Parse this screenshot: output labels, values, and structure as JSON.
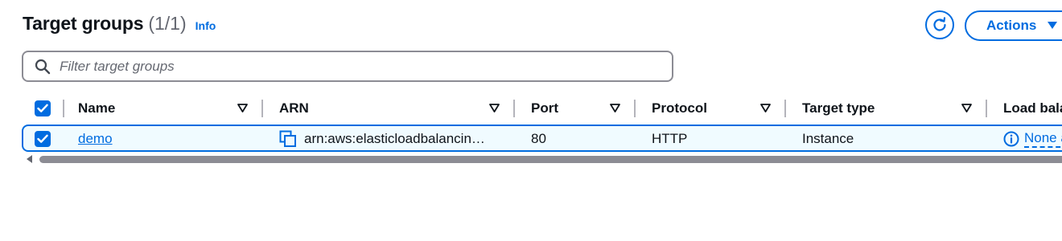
{
  "header": {
    "title": "Target groups",
    "count": "(1/1)",
    "info_label": "Info"
  },
  "toolbar": {
    "refresh_icon": "refresh-icon",
    "actions_label": "Actions",
    "actions_icon": "caret-down-icon"
  },
  "search": {
    "placeholder": "Filter target groups",
    "value": ""
  },
  "table": {
    "select_all_checked": true,
    "columns": [
      {
        "label": "Name"
      },
      {
        "label": "ARN"
      },
      {
        "label": "Port"
      },
      {
        "label": "Protocol"
      },
      {
        "label": "Target type"
      },
      {
        "label": "Load bala"
      }
    ],
    "rows": [
      {
        "selected": true,
        "name": "demo",
        "arn": "arn:aws:elasticloadbalancin…",
        "port": "80",
        "protocol": "HTTP",
        "target_type": "Instance",
        "load_balancer": "None a"
      }
    ]
  },
  "colors": {
    "accent": "#006ce0",
    "text": "#0f141a",
    "muted": "#656871",
    "selected_row_bg": "#f0fbff"
  }
}
